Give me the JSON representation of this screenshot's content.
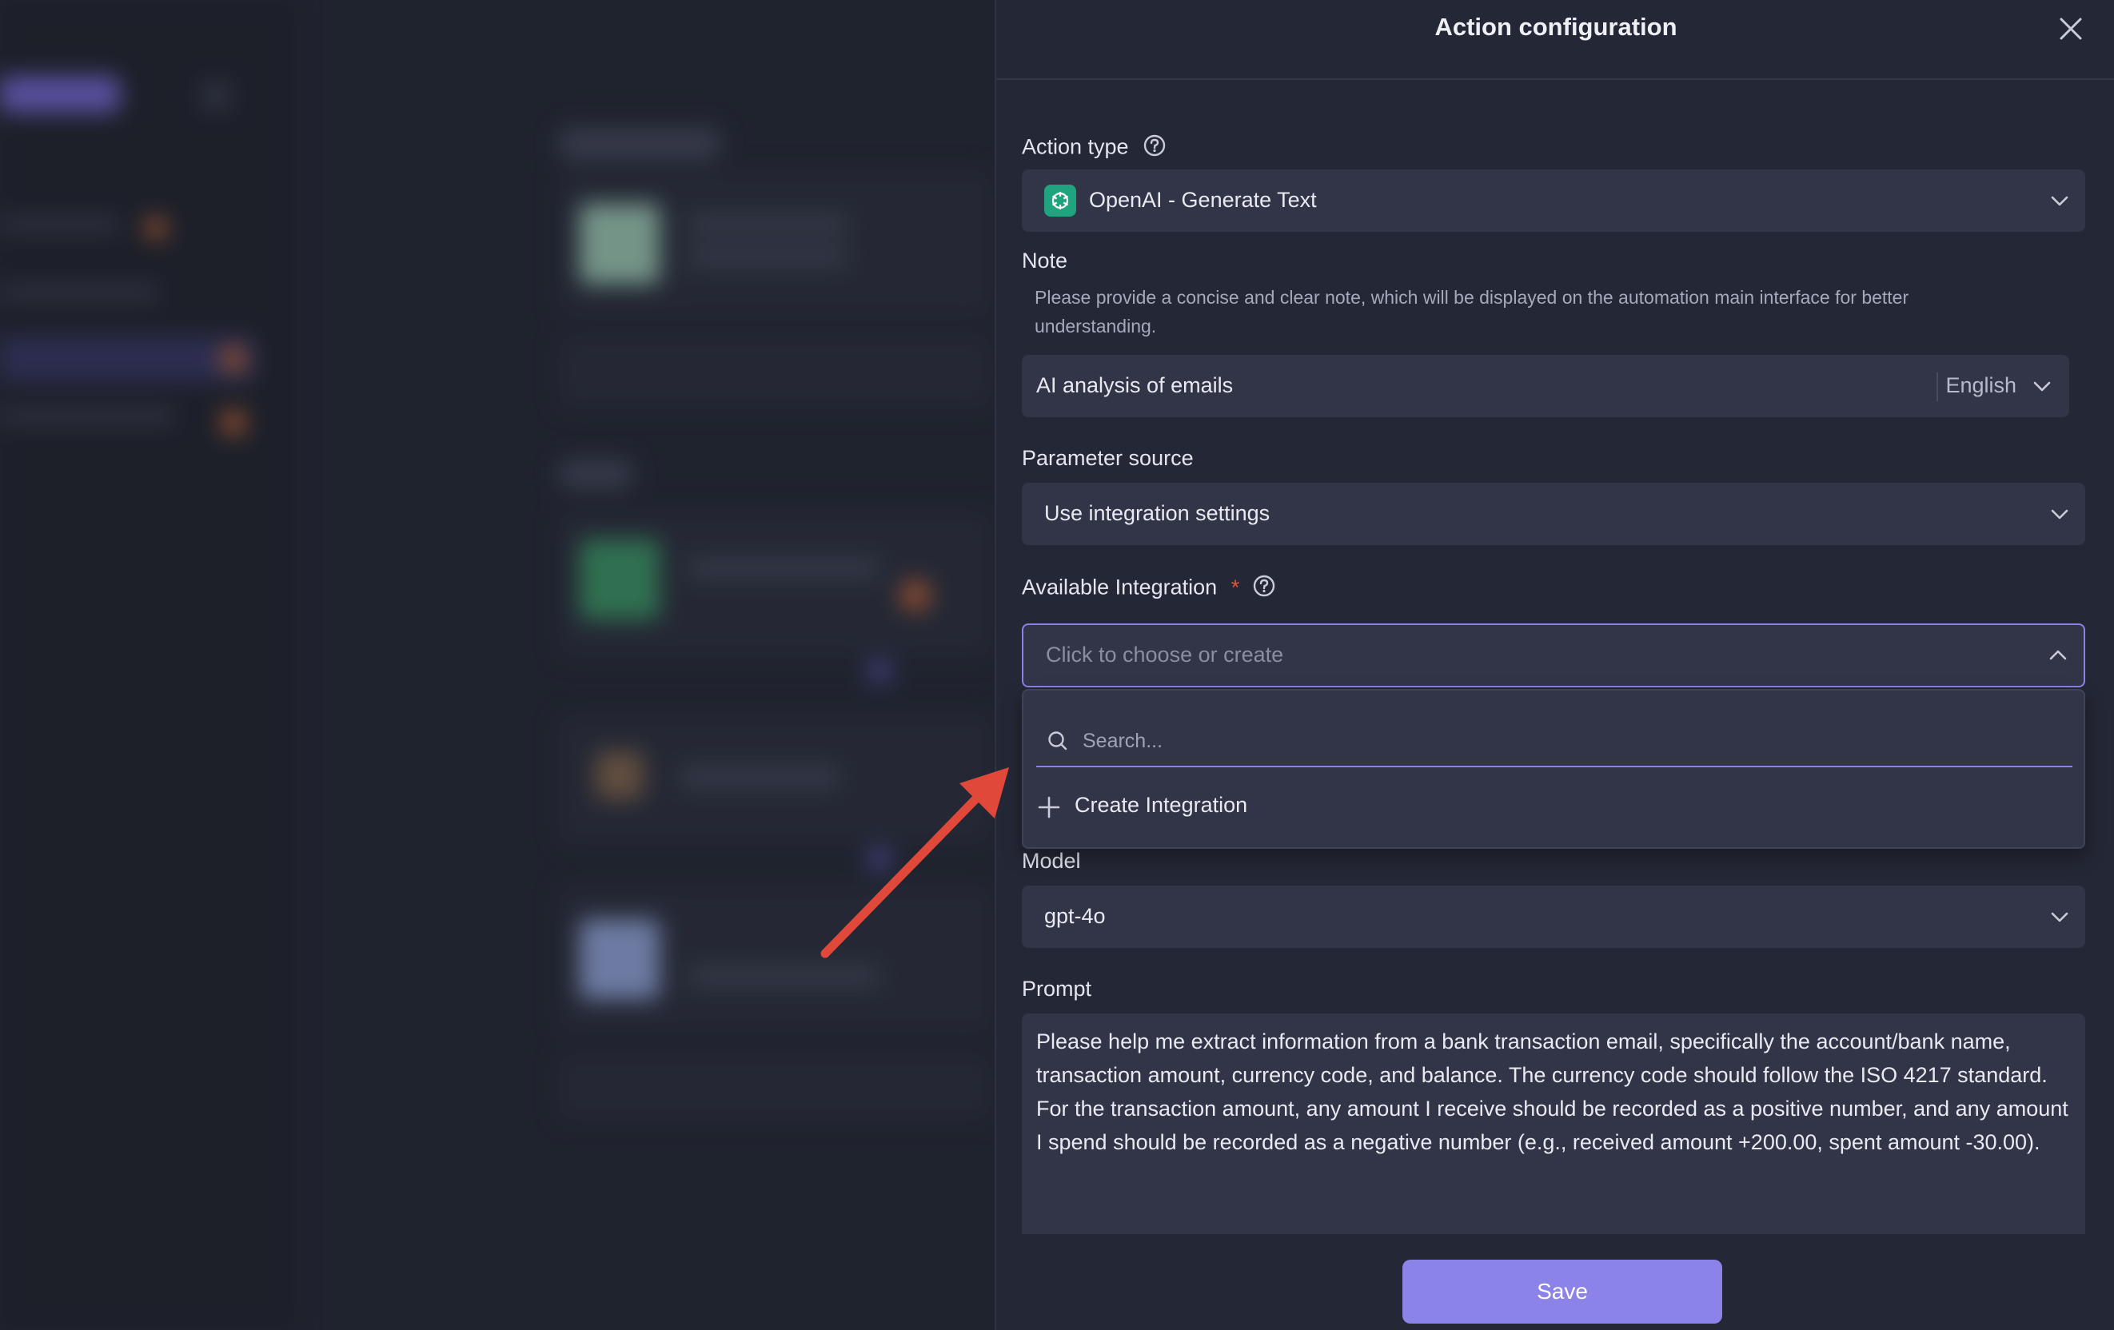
{
  "panel": {
    "title": "Action configuration",
    "close_icon": "close-icon",
    "action_type": {
      "label": "Action type",
      "help_icon": "question-circle-icon",
      "value": "OpenAI - Generate Text",
      "icon": "openai-logo-icon"
    },
    "note": {
      "label": "Note",
      "help_text": "Please provide a concise and clear note, which will be displayed on the automation main interface for better understanding.",
      "value": "AI analysis of emails",
      "language": "English"
    },
    "parameter_source": {
      "label": "Parameter source",
      "value": "Use integration settings"
    },
    "available_integration": {
      "label": "Available Integration",
      "required_mark": "*",
      "placeholder": "Click to choose or create",
      "dropdown": {
        "search_placeholder": "Search...",
        "create_label": "Create Integration"
      }
    },
    "model": {
      "label": "Model",
      "value": "gpt-4o"
    },
    "prompt": {
      "label": "Prompt",
      "value": "Please help me extract information from a bank transaction email, specifically the account/bank name, transaction amount, currency code, and balance. The currency code should follow the ISO 4217 standard. For the transaction amount, any amount I receive should be recorded as a positive number, and any amount I spend should be recorded as a negative number (e.g., received amount +200.00, spent amount -30.00)."
    },
    "save_label": "Save"
  },
  "colors": {
    "accent": "#8c83e9",
    "required": "#e5533d",
    "annotation_arrow": "#e0483a",
    "openai_green": "#20a37f"
  }
}
